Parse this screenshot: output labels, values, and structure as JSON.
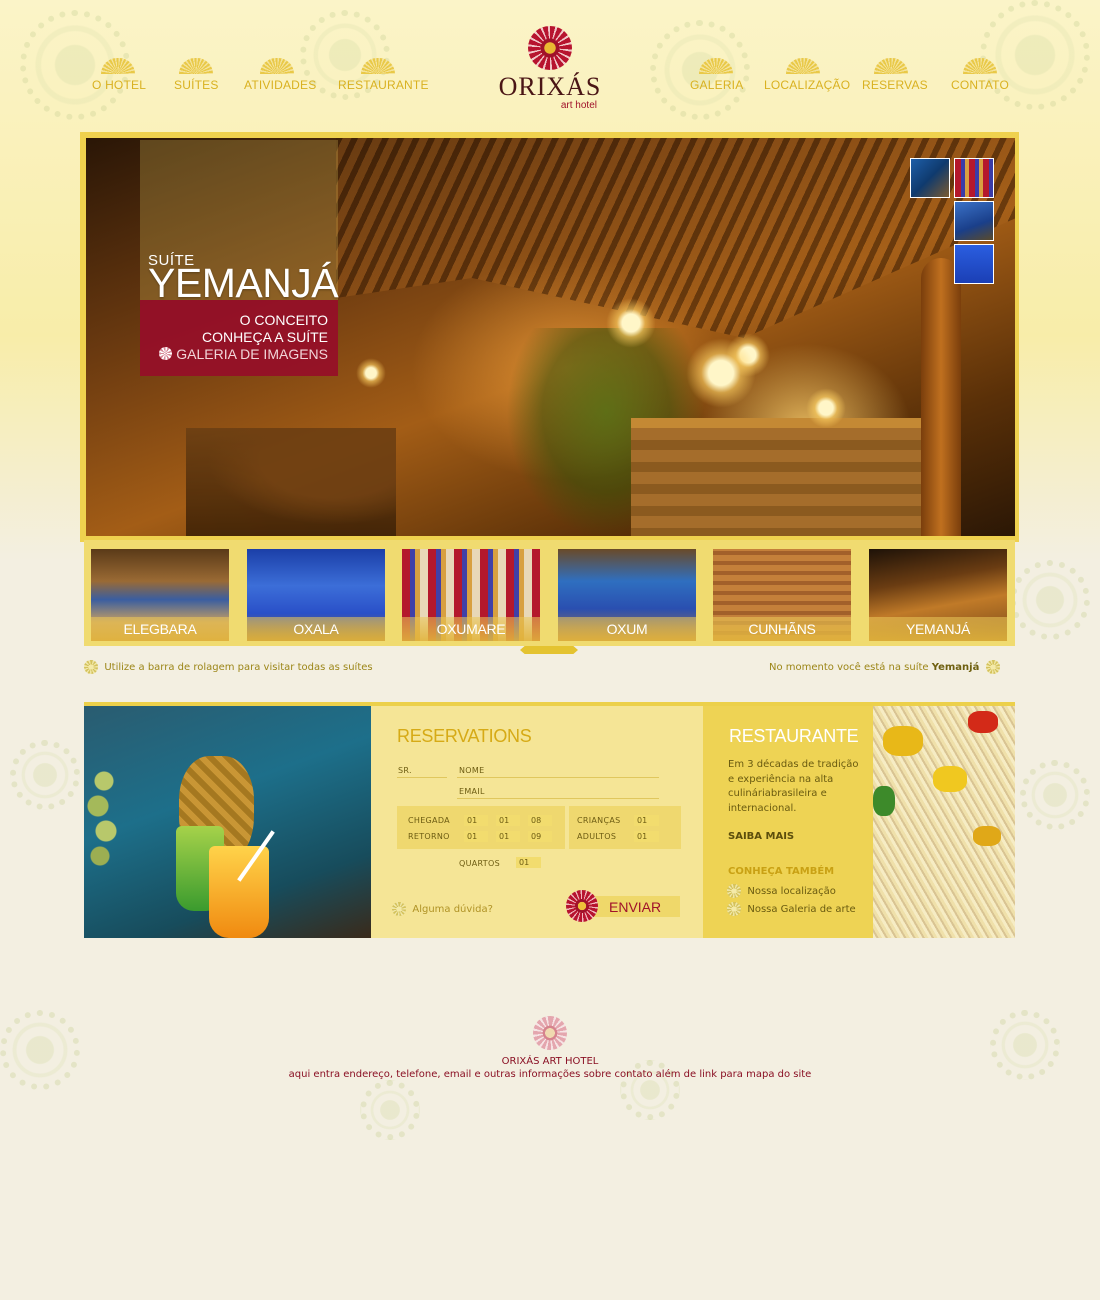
{
  "nav": {
    "left": [
      "O HOTEL",
      "SUÍTES",
      "ATIVIDADES",
      "RESTAURANTE"
    ],
    "right": [
      "GALERIA",
      "LOCALIZAÇÃO",
      "RESERVAS",
      "CONTATO"
    ]
  },
  "logo": {
    "name": "ORIXÁS",
    "subtitle": "art hotel"
  },
  "hero": {
    "suite_label": "SUÍTE",
    "suite_name": "YEMANJÁ",
    "links": [
      "O CONCEITO",
      "CONHEÇA A SUÍTE",
      "GALERIA DE IMAGENS"
    ]
  },
  "suites": [
    "ELEGBARA",
    "OXALA",
    "OXUMARE",
    "OXUM",
    "CUNHÃNS",
    "YEMANJÁ"
  ],
  "hints": {
    "scroll": "Utilize a barra de rolagem para visitar todas as suítes",
    "current_prefix": "No momento você está na suíte",
    "current_suite": "Yemanjá"
  },
  "reservations": {
    "title": "RESERVATIONS",
    "sr_label": "SR.",
    "name_label": "NOME",
    "email_label": "EMAIL",
    "checkin_label": "CHEGADA",
    "checkout_label": "RETORNO",
    "checkin": [
      "01",
      "01",
      "08"
    ],
    "checkout": [
      "01",
      "01",
      "09"
    ],
    "children_label": "CRIANÇAS",
    "children": "01",
    "adults_label": "ADULTOS",
    "adults": "01",
    "rooms_label": "QUARTOS",
    "rooms": "01",
    "question": "Alguma dúvida?",
    "submit": "ENVIAR"
  },
  "restaurant": {
    "title": "RESTAURANTE",
    "text": "Em 3 décadas de tradição e experiência na alta culináriabrasileira e internacional.",
    "more": "SAIBA MAIS",
    "also_title": "CONHEÇA TAMBÉM",
    "links": [
      "Nossa localização",
      "Nossa Galeria de arte"
    ]
  },
  "footer": {
    "name": "ORIXÁS ART HOTEL",
    "info": "aqui entra endereço, telefone, email e outras informações sobre contato além de link para mapa do site"
  },
  "colors": {
    "accent_gold": "#d9b120",
    "brand_red": "#a0122a",
    "background": "#f3efe1"
  }
}
